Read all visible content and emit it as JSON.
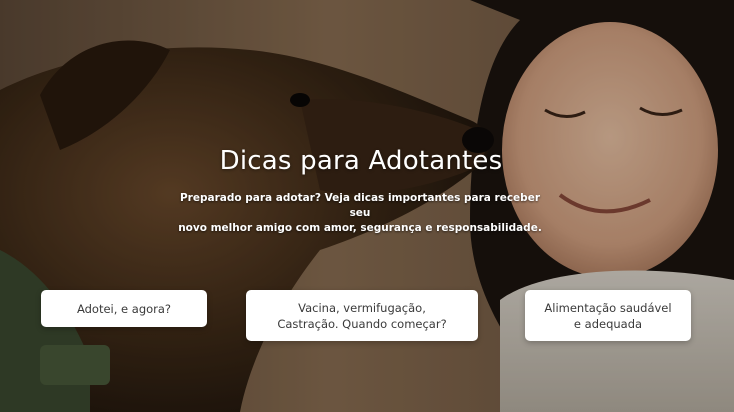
{
  "hero": {
    "title": "Dicas para Adotantes",
    "subtitle_line1": "Preparado para adotar? Veja dicas importantes para receber seu",
    "subtitle_line2": "novo melhor amigo com amor, segurança e responsabilidade."
  },
  "cards": [
    {
      "line1": "Adotei, e agora?",
      "line2": ""
    },
    {
      "line1": "Vacina, vermifugação,",
      "line2": "Castração. Quando começar?"
    },
    {
      "line1": "Alimentação saudável",
      "line2": "e adequada"
    }
  ],
  "colors": {
    "card_background": "#ffffff",
    "card_text": "#3a3a3a",
    "hero_text": "#ffffff"
  }
}
